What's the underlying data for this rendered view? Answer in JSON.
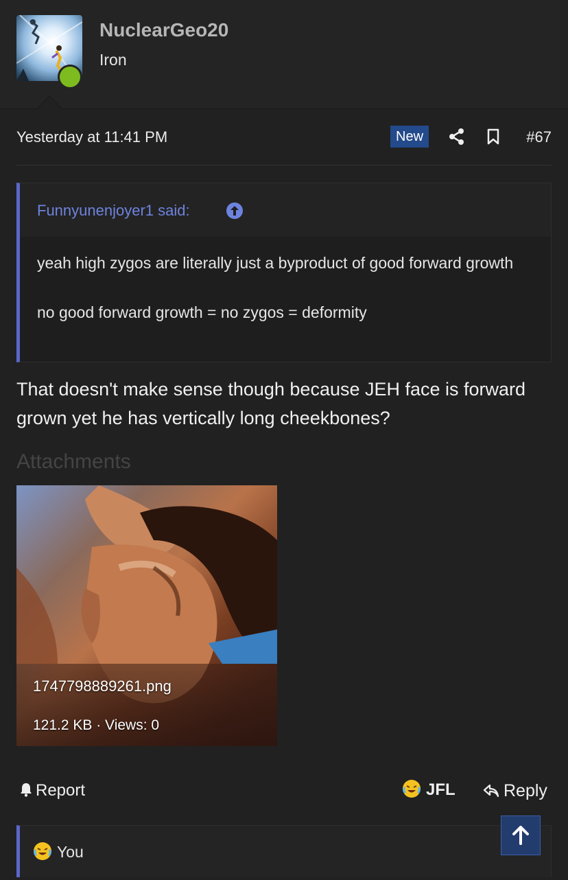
{
  "user": {
    "name": "NuclearGeo20",
    "title": "Iron",
    "online": true
  },
  "post": {
    "date": "Yesterday at 11:41 PM",
    "badge": "New",
    "number": "#67",
    "quote": {
      "author_line": "Funnyunenjoyer1 said:",
      "paragraphs": [
        "yeah high zygos are literally just a byproduct of good forward growth",
        "no good forward growth = no zygos = deformity"
      ]
    },
    "body": "That doesn't make sense though because JEH face is forward grown yet he has vertically long cheekbones?",
    "attachments_heading": "Attachments",
    "attachment": {
      "filename": "1747798889261.png",
      "info": "121.2 KB · Views: 0"
    }
  },
  "actions": {
    "report": "Report",
    "reaction": "JFL",
    "reply": "Reply"
  },
  "reactions": {
    "text": "You"
  },
  "colors": {
    "accent": "#5a68c9",
    "link": "#6e83df",
    "online": "#7dbb1f",
    "badge": "#234a8b"
  }
}
